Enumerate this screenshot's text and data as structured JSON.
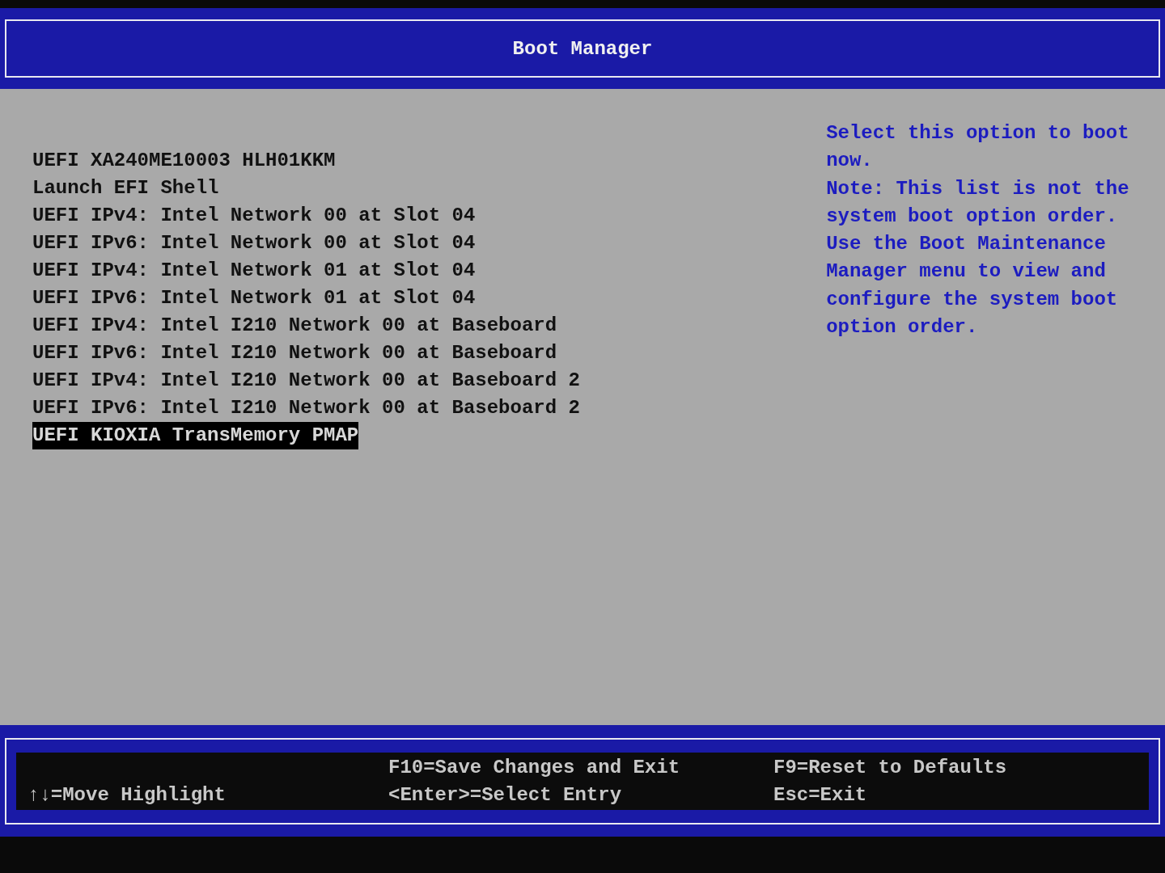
{
  "header": {
    "title": "Boot Manager"
  },
  "boot_options": [
    {
      "label": "UEFI XA240ME10003 HLH01KKM",
      "selected": false
    },
    {
      "label": "Launch EFI Shell",
      "selected": false
    },
    {
      "label": "UEFI IPv4: Intel Network 00 at Slot 04",
      "selected": false
    },
    {
      "label": "UEFI IPv6: Intel Network 00 at Slot 04",
      "selected": false
    },
    {
      "label": "UEFI IPv4: Intel Network 01 at Slot 04",
      "selected": false
    },
    {
      "label": "UEFI IPv6: Intel Network 01 at Slot 04",
      "selected": false
    },
    {
      "label": "UEFI IPv4: Intel I210 Network 00 at Baseboard",
      "selected": false
    },
    {
      "label": "UEFI IPv6: Intel I210 Network 00 at Baseboard",
      "selected": false
    },
    {
      "label": "UEFI IPv4: Intel I210 Network 00 at Baseboard 2",
      "selected": false
    },
    {
      "label": "UEFI IPv6: Intel I210 Network 00 at Baseboard 2",
      "selected": false
    },
    {
      "label": "UEFI KIOXIA TransMemory PMAP",
      "selected": true
    }
  ],
  "help": [
    "Select this option to boot now.",
    "Note: This list is not the system boot option order. Use the Boot Maintenance Manager menu to view and configure the system boot option order."
  ],
  "footer": {
    "columns": [
      [
        "",
        "↑↓=Move Highlight"
      ],
      [
        "F10=Save Changes and Exit",
        "<Enter>=Select Entry"
      ],
      [
        "F9=Reset to Defaults",
        "Esc=Exit"
      ]
    ]
  }
}
